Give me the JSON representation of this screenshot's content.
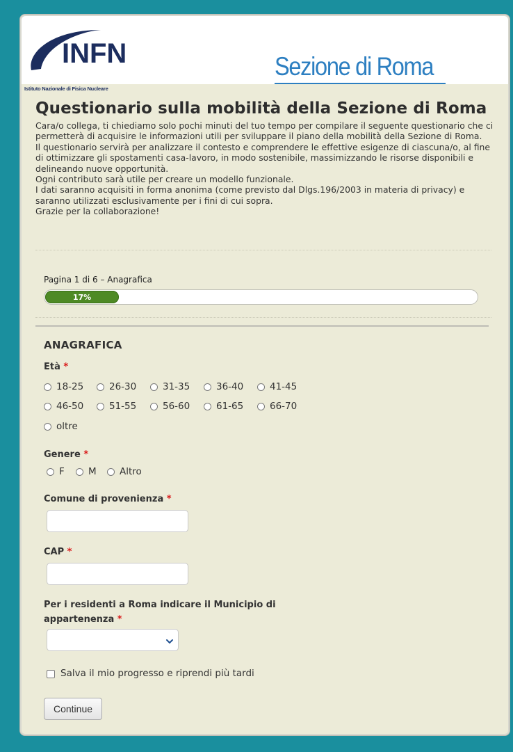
{
  "header": {
    "logo_text": "INFN",
    "logo_caption": "Istituto Nazionale di Fisica Nucleare",
    "section_name": "Sezione di Roma"
  },
  "survey": {
    "title": "Questionario sulla mobilità della Sezione di Roma",
    "intro_lines": [
      "Cara/o collega, ti chiediamo solo pochi minuti del tuo tempo per compilare il seguente questionario che ci permetterà di acquisire le informazioni utili per sviluppare il piano della mobilità della Sezione di Roma.",
      "Il questionario servirà per analizzare il contesto e comprendere le effettive esigenze di ciascuna/o, al fine di ottimizzare gli spostamenti casa-lavoro, in modo sostenibile, massimizzando le risorse disponibili e delineando nuove opportunità.",
      "Ogni contributo sarà utile per creare un modello funzionale.",
      "I dati saranno acquisiti in forma anonima (come previsto dal Dlgs.196/2003 in materia di privacy) e saranno utilizzati esclusivamente per i fini di cui sopra.",
      "Grazie per la collaborazione!"
    ]
  },
  "progress": {
    "page_label": "Pagina 1 di 6 – Anagrafica",
    "percent": 17,
    "percent_label": "17%"
  },
  "section": {
    "title": "ANAGRAFICA"
  },
  "questions": {
    "required_marker": "*",
    "eta": {
      "label": "Età",
      "options": [
        "18-25",
        "26-30",
        "31-35",
        "36-40",
        "41-45",
        "46-50",
        "51-55",
        "56-60",
        "61-65",
        "66-70",
        "oltre"
      ]
    },
    "genere": {
      "label": "Genere",
      "options": [
        "F",
        "M",
        "Altro"
      ]
    },
    "comune": {
      "label": "Comune di provenienza",
      "value": ""
    },
    "cap": {
      "label": "CAP",
      "value": ""
    },
    "municipio": {
      "label_line1": "Per i residenti a Roma indicare il Municipio di",
      "label_line2": "appartenenza",
      "selected": ""
    }
  },
  "save_progress_label": "Salva il mio progresso e riprendi più tardi",
  "continue_label": "Continue",
  "colors": {
    "page_bg": "#1a8f9e",
    "form_bg": "#ecebd8",
    "progress_fill": "#4e8a25",
    "heading_blue": "#2d7fc1",
    "logo_navy": "#1c2d5e",
    "required": "#d91919"
  }
}
